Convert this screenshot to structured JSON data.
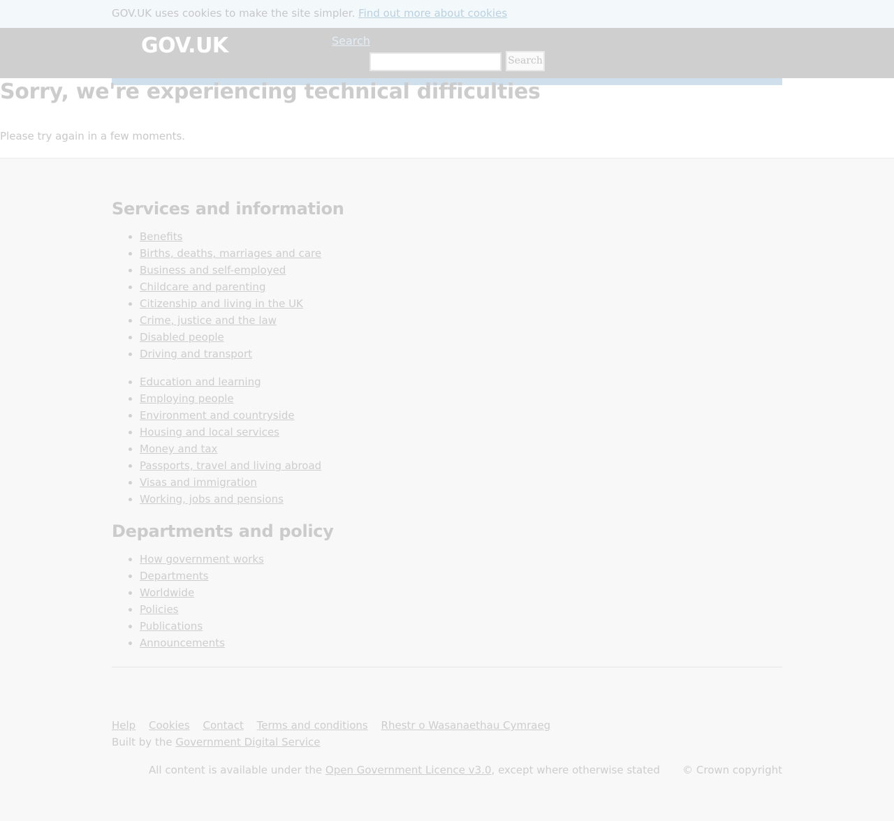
{
  "cookie_banner": {
    "text": "GOV.UK uses cookies to make the site simpler.",
    "link": "Find out more about cookies"
  },
  "header": {
    "logo": "GOV.UK",
    "search_link": "Search",
    "search_button": "Search",
    "search_value": ""
  },
  "main": {
    "title": "Sorry, we're experiencing technical difficulties",
    "body": "Please try again in a few moments."
  },
  "footer": {
    "services": {
      "heading": "Services and information",
      "column1": [
        "Benefits",
        "Births, deaths, marriages and care",
        "Business and self-employed",
        "Childcare and parenting",
        "Citizenship and living in the UK",
        "Crime, justice and the law",
        "Disabled people",
        "Driving and transport"
      ],
      "column2": [
        "Education and learning",
        "Employing people",
        "Environment and countryside",
        "Housing and local services",
        "Money and tax",
        "Passports, travel and living abroad",
        "Visas and immigration",
        "Working, jobs and pensions"
      ]
    },
    "departments": {
      "heading": "Departments and policy",
      "items": [
        "How government works",
        "Departments",
        "Worldwide",
        "Policies",
        "Publications",
        "Announcements"
      ]
    },
    "meta_links": [
      "Help",
      "Cookies",
      "Contact",
      "Terms and conditions",
      "Rhestr o Wasanaethau Cymraeg"
    ],
    "built_by_text": "Built by the",
    "built_by_link": "Government Digital Service",
    "licence_prefix": "All content is available under the",
    "licence_link": "Open Government Licence v3.0",
    "licence_suffix": ", except where otherwise stated",
    "copyright": "© Crown copyright"
  }
}
